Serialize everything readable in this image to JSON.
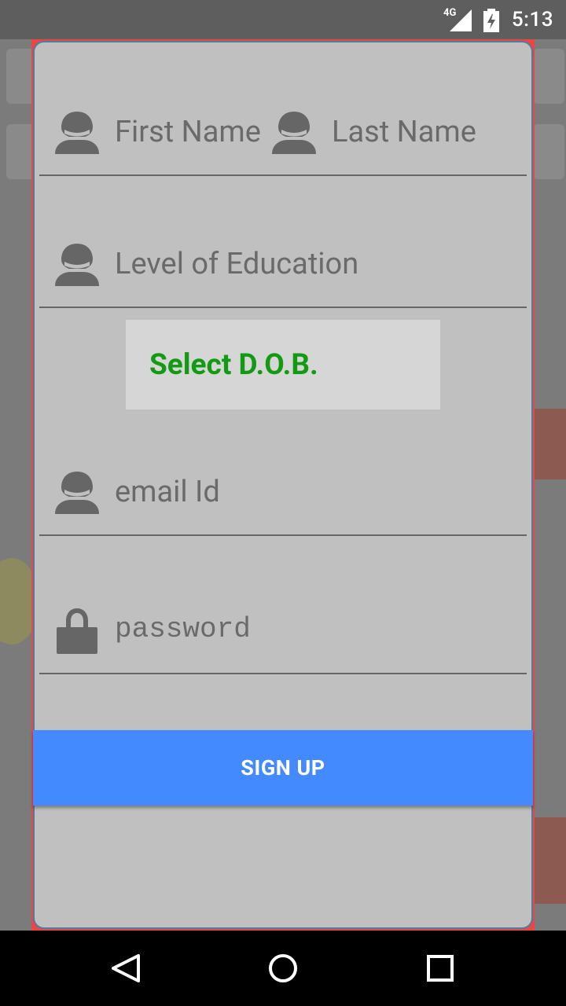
{
  "status_bar": {
    "time": "5:13",
    "network": "4G",
    "icons": [
      "signal-icon",
      "battery-charging-icon"
    ]
  },
  "form": {
    "first_name_placeholder": "First Name",
    "last_name_placeholder": "Last Name",
    "education_placeholder": "Level of Education",
    "dob_button_label": "Select D.O.B.",
    "email_placeholder": "email Id",
    "password_placeholder": "password",
    "signup_button_label": "SIGN UP"
  },
  "colors": {
    "dialog_bg": "#c0c0c0",
    "dob_text": "#129a12",
    "signup_button": "#448aff"
  },
  "nav_bar": {
    "icons": [
      "back-icon",
      "home-icon",
      "recents-icon"
    ]
  }
}
